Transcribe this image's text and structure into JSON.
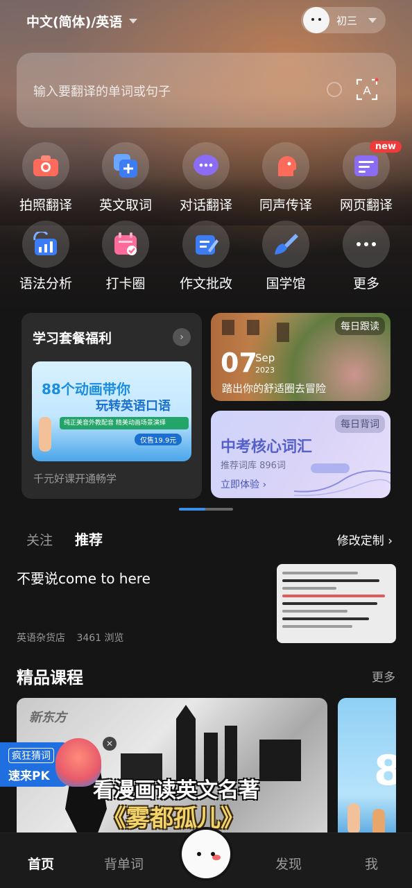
{
  "header": {
    "language": "中文(简体)/英语",
    "user_name": "初三"
  },
  "search": {
    "placeholder": "输入要翻译的单词或句子"
  },
  "tools": [
    {
      "label": "拍照翻译",
      "icon": "camera-icon",
      "color": "#ff6b5a"
    },
    {
      "label": "英文取词",
      "icon": "add-word-icon",
      "color": "#3d7cf2"
    },
    {
      "label": "对话翻译",
      "icon": "chat-bubble-icon",
      "color": "#8b6cf5"
    },
    {
      "label": "同声传译",
      "icon": "speaker-head-icon",
      "color": "#ff6b5a"
    },
    {
      "label": "网页翻译",
      "icon": "webpage-icon",
      "color": "#8b6cf5",
      "badge": "new"
    },
    {
      "label": "语法分析",
      "icon": "grammar-chart-icon",
      "color": "#3d7cf2"
    },
    {
      "label": "打卡圈",
      "icon": "calendar-check-icon",
      "color": "#ff6b9a"
    },
    {
      "label": "作文批改",
      "icon": "essay-edit-icon",
      "color": "#3d7cf2"
    },
    {
      "label": "国学馆",
      "icon": "brush-icon",
      "color": "#3d7cf2"
    },
    {
      "label": "更多",
      "icon": "more-icon",
      "color": "#ffffff"
    }
  ],
  "promo": {
    "title": "学习套餐福利",
    "banner_line1": "88个动画带你",
    "banner_line2": "玩转英语口语",
    "banner_line3": "纯正美音外教配音  精美动画场景演绎",
    "banner_price": "仅售19.9元",
    "subtitle": "千元好课开通畅学"
  },
  "daily_reading": {
    "tag": "每日跟读",
    "day": "07",
    "month": "Sep",
    "year": "2023",
    "quote": "踏出你的舒适圈去冒险"
  },
  "daily_vocab": {
    "tag": "每日背词",
    "title": "中考核心词汇",
    "subtitle": "推荐词库 896词",
    "cta": "立即体验 ›"
  },
  "feed": {
    "tabs": [
      {
        "label": "关注",
        "active": false
      },
      {
        "label": "推荐",
        "active": true
      }
    ],
    "customize": "修改定制 ›",
    "article": {
      "title": "不要说come to here",
      "source": "英语杂货店",
      "views": "3461 浏览"
    }
  },
  "courses": {
    "title": "精品课程",
    "more": "更多",
    "card1_logo": "新东方",
    "card1_title1": "看漫画读英文名著",
    "card1_title2": "《雾都孤儿》"
  },
  "floating_ad": {
    "line1": "疯狂猜词",
    "line2": "速来PK"
  },
  "bottom_nav": {
    "items": [
      {
        "label": "首页",
        "active": true
      },
      {
        "label": "背单词",
        "active": false
      },
      {
        "label": "发现",
        "active": false
      },
      {
        "label": "我",
        "active": false
      }
    ]
  }
}
